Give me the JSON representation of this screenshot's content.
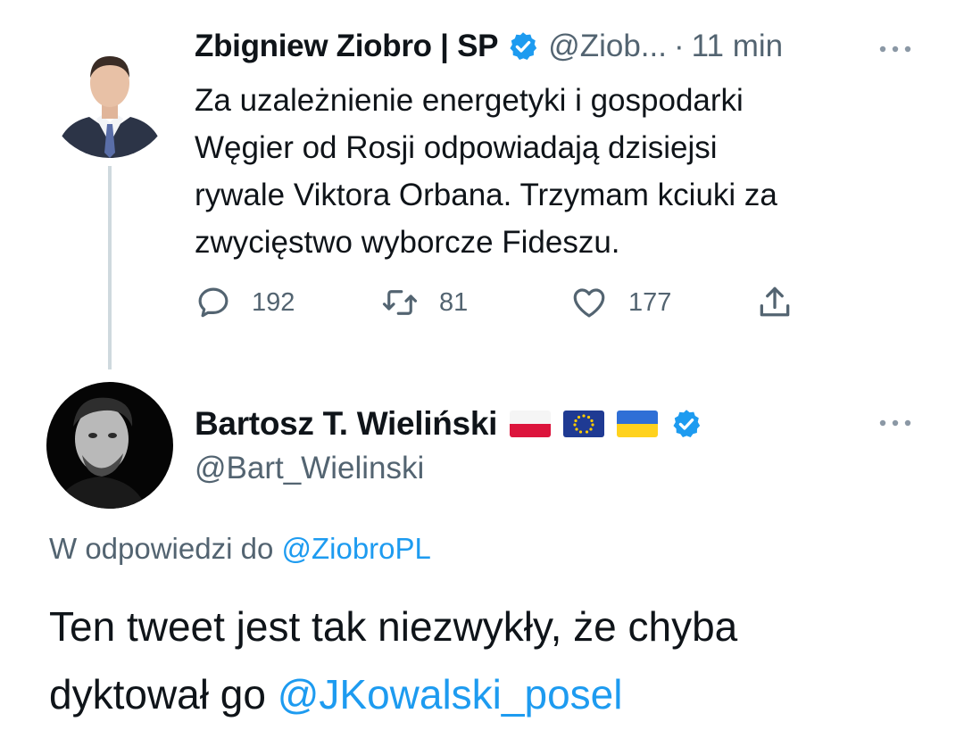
{
  "original_tweet": {
    "author_name": "Zbigniew Ziobro | SP",
    "handle": "@Ziob...",
    "separator": "·",
    "time": "11 min",
    "text_lines": [
      "Za uzależnienie energetyki i gospodarki",
      "Węgier od Rosji odpowiadają dzisiejsi",
      "rywale Viktora Orbana. Trzymam kciuki za",
      "zwycięstwo wyborcze Fideszu."
    ],
    "replies": "192",
    "retweets": "81",
    "likes": "177",
    "verified": true
  },
  "reply_tweet": {
    "author_name": "Bartosz T. Wieliński",
    "flags": [
      "poland-flag-icon",
      "eu-flag-icon",
      "ukraine-flag-icon"
    ],
    "handle": "@Bart_Wielinski",
    "reply_to_prefix": "W odpowiedzi do",
    "reply_to_mention": "@ZiobroPL",
    "text_line1": "Ten tweet jest tak niezwykły, że chyba",
    "text_line2_prefix": "dyktował go",
    "text_line2_mention": "@JKowalski_posel",
    "verified": true
  },
  "colors": {
    "text": "#0f1419",
    "secondary": "#536471",
    "accent": "#1d9bf0",
    "thread_line": "#cfd9de"
  },
  "icons": [
    "reply-icon",
    "retweet-icon",
    "like-icon",
    "share-icon",
    "more-icon",
    "verified-badge-icon"
  ]
}
